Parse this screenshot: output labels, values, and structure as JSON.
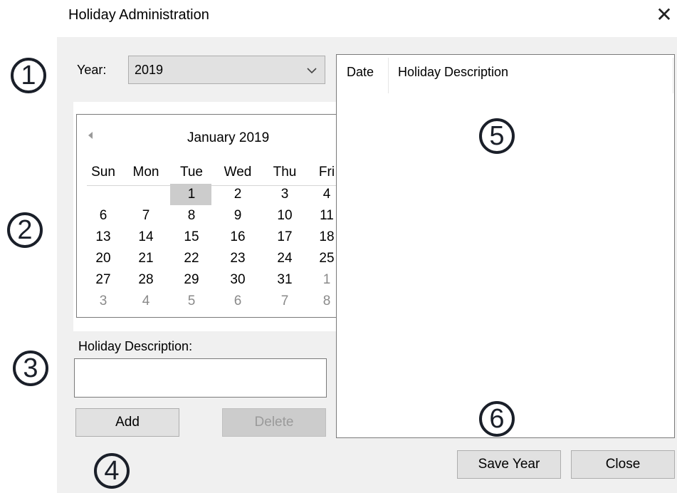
{
  "window": {
    "title": "Holiday Administration"
  },
  "year": {
    "label": "Year:",
    "value": "2019"
  },
  "calendar": {
    "month_title": "January 2019",
    "weekdays": [
      "Sun",
      "Mon",
      "Tue",
      "Wed",
      "Thu",
      "Fri"
    ],
    "weeks": [
      [
        {
          "d": "",
          "o": false
        },
        {
          "d": "",
          "o": false
        },
        {
          "d": "1",
          "o": false
        },
        {
          "d": "2",
          "o": false
        },
        {
          "d": "3",
          "o": false
        },
        {
          "d": "4",
          "o": false
        }
      ],
      [
        {
          "d": "6",
          "o": false
        },
        {
          "d": "7",
          "o": false
        },
        {
          "d": "8",
          "o": false
        },
        {
          "d": "9",
          "o": false
        },
        {
          "d": "10",
          "o": false
        },
        {
          "d": "11",
          "o": false
        }
      ],
      [
        {
          "d": "13",
          "o": false
        },
        {
          "d": "14",
          "o": false
        },
        {
          "d": "15",
          "o": false
        },
        {
          "d": "16",
          "o": false
        },
        {
          "d": "17",
          "o": false
        },
        {
          "d": "18",
          "o": false
        }
      ],
      [
        {
          "d": "20",
          "o": false
        },
        {
          "d": "21",
          "o": false
        },
        {
          "d": "22",
          "o": false
        },
        {
          "d": "23",
          "o": false
        },
        {
          "d": "24",
          "o": false
        },
        {
          "d": "25",
          "o": false
        }
      ],
      [
        {
          "d": "27",
          "o": false
        },
        {
          "d": "28",
          "o": false
        },
        {
          "d": "29",
          "o": false
        },
        {
          "d": "30",
          "o": false
        },
        {
          "d": "31",
          "o": false
        },
        {
          "d": "1",
          "o": true
        }
      ],
      [
        {
          "d": "3",
          "o": true
        },
        {
          "d": "4",
          "o": true
        },
        {
          "d": "5",
          "o": true
        },
        {
          "d": "6",
          "o": true
        },
        {
          "d": "7",
          "o": true
        },
        {
          "d": "8",
          "o": true
        }
      ]
    ],
    "selected_day": "1"
  },
  "description": {
    "label": "Holiday Description:",
    "value": ""
  },
  "buttons": {
    "add": "Add",
    "delete": "Delete",
    "save_year": "Save Year",
    "close": "Close"
  },
  "holiday_list": {
    "columns": [
      "Date",
      "Holiday Description"
    ],
    "rows": []
  },
  "callouts": [
    "1",
    "2",
    "3",
    "4",
    "5",
    "6"
  ]
}
